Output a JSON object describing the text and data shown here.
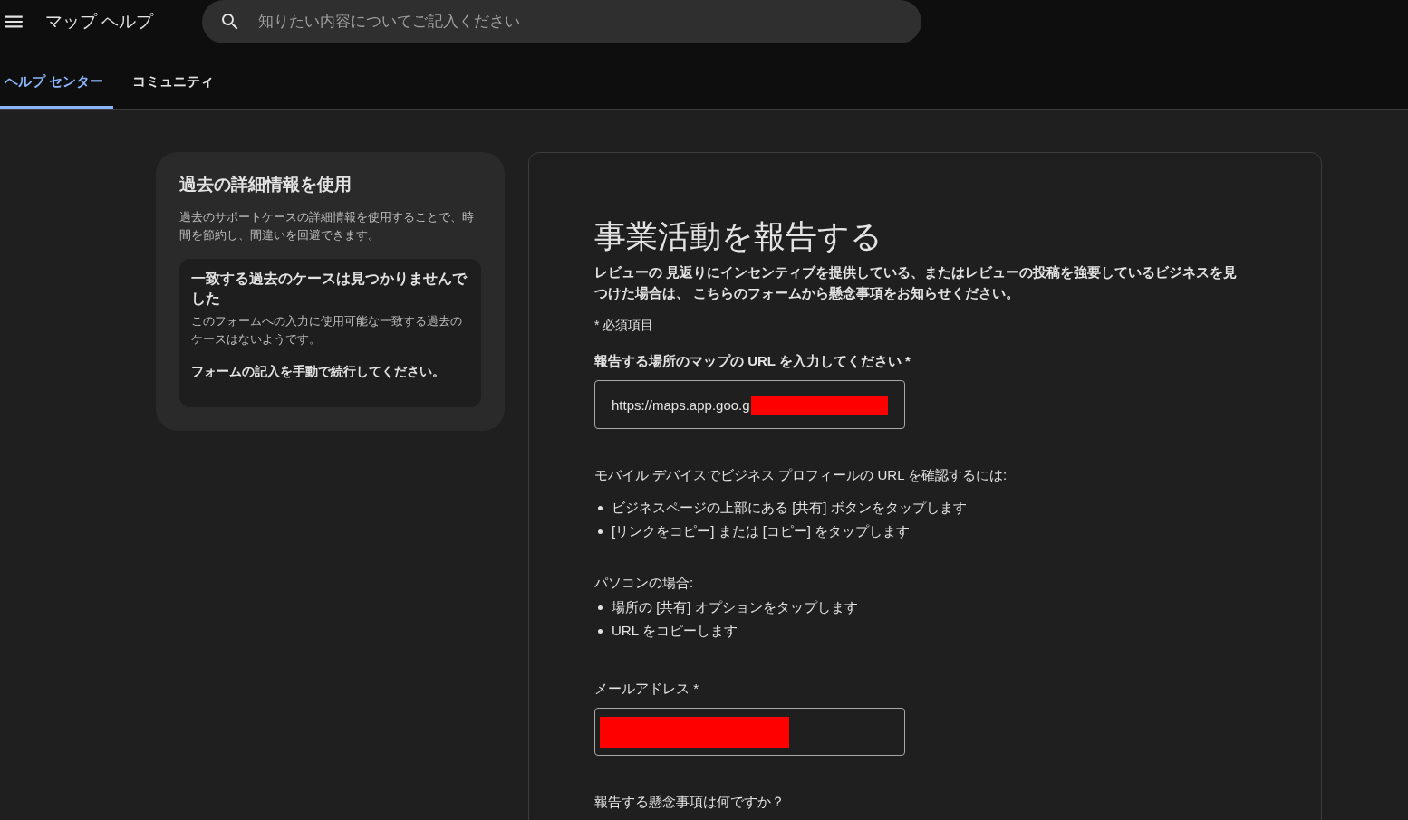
{
  "header": {
    "title": "マップ ヘルプ",
    "search": {
      "placeholder": "知りたい内容についてご記入ください"
    }
  },
  "tabs": [
    {
      "label": "ヘルプ センター",
      "selected": true
    },
    {
      "label": "コミュニティ",
      "selected": false
    }
  ],
  "past_details": {
    "title": "過去の詳細情報を使用",
    "description": "過去のサポートケースの詳細情報を使用することで、時間を節約し、間違いを回避できます。",
    "result": {
      "title": "一致する過去のケースは見つかりませんでした",
      "description": "このフォームへの入力に使用可能な一致する過去のケースはないようです。",
      "instruction": "フォームの記入を手動で続行してください。"
    }
  },
  "form": {
    "title": "事業活動を報告する",
    "intro": "レビューの 見返りにインセンティブを提供している、またはレビューの投稿を強要しているビジネスを見つけた場合は、 こちらのフォームから懸念事項をお知らせください。",
    "required_note": "* 必須項目",
    "items": [
      {
        "kind": "input",
        "label": "報告する場所のマップの URL を入力してください *",
        "emphasized": true,
        "value": "https://maps.app.goo.g",
        "redacted": true
      },
      {
        "kind": "help",
        "heading": "モバイル デバイスでビジネス プロフィールの URL を確認するには:",
        "bullets": [
          "ビジネスページの上部にある [共有] ボタンをタップします",
          "[リンクをコピー] または [コピー] をタップします"
        ]
      },
      {
        "kind": "help",
        "heading": "パソコンの場合:",
        "bullets": [
          "場所の [共有] オプションをタップします",
          "URL をコピーします"
        ]
      },
      {
        "kind": "input",
        "label": "メールアドレス *",
        "emphasized": false,
        "redacted": true
      },
      {
        "kind": "question",
        "label": "報告する懸念事項は何ですか？"
      }
    ]
  }
}
